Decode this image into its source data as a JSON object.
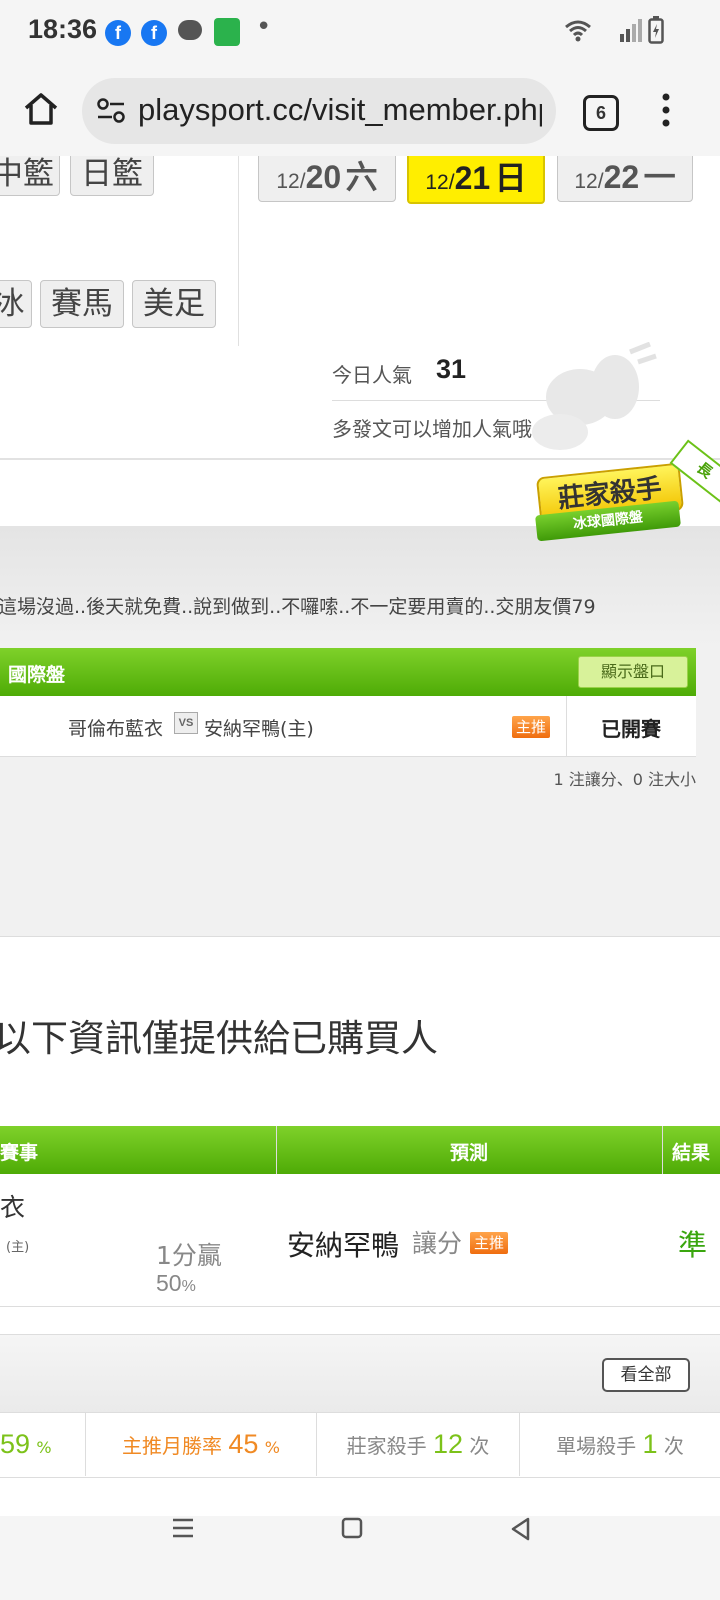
{
  "status_bar": {
    "time": "18:36",
    "notification_dot": "•"
  },
  "browser": {
    "url": "playsport.cc/visit_member.php",
    "tab_count": "6"
  },
  "sports": {
    "row1": [
      "中籃",
      "日籃"
    ],
    "row2": [
      "冰",
      "賽馬",
      "美足"
    ]
  },
  "dates": [
    {
      "md": "12/",
      "day": "20",
      "weekday": "六"
    },
    {
      "md": "12/",
      "day": "21",
      "weekday": "日"
    },
    {
      "md": "12/",
      "day": "22",
      "weekday": "一"
    }
  ],
  "popularity": {
    "label": "今日人氣",
    "value": "31",
    "tip": "多發文可以增加人氣哦～"
  },
  "badge": {
    "title": "莊家殺手",
    "subtitle": "冰球國際盤",
    "ribbon": "長"
  },
  "post": {
    "message": "這場沒過..後天就免費..說到做到..不囉嗦..不一定要用賣的..交朋友價79",
    "table_title": "國際盤",
    "show_odds_button": "顯示盤口",
    "team_away": "哥倫布藍衣",
    "vs": "VS",
    "team_home": "安納罕鴨(主)",
    "main_pick_tag": "主推",
    "status": "已開賽",
    "summary": "1 注讓分、0 注大小"
  },
  "buyer_section": {
    "heading": "以下資訊僅提供給已購買人",
    "headers": [
      "賽事",
      "預測",
      "結果"
    ],
    "row": {
      "team_fragment": "衣",
      "home_mark": "(主)",
      "margin": "1分贏",
      "pct_value": "50",
      "pct_unit": "%",
      "pick_team": "安納罕鴨",
      "pick_type": "讓分",
      "pick_tag": "主推",
      "result": "準"
    }
  },
  "view_all_button": "看全部",
  "stats": {
    "rate_value": "59",
    "rate_unit": "%",
    "monthly_label": "主推月勝率",
    "monthly_value": "45",
    "monthly_unit": "%",
    "killer_label": "莊家殺手",
    "killer_value": "12",
    "killer_unit": "次",
    "single_label": "單場殺手",
    "single_value": "1",
    "single_unit": "次"
  },
  "colors": {
    "green": "#5cb910",
    "yellow": "#ffee00",
    "orange": "#f08a24"
  }
}
